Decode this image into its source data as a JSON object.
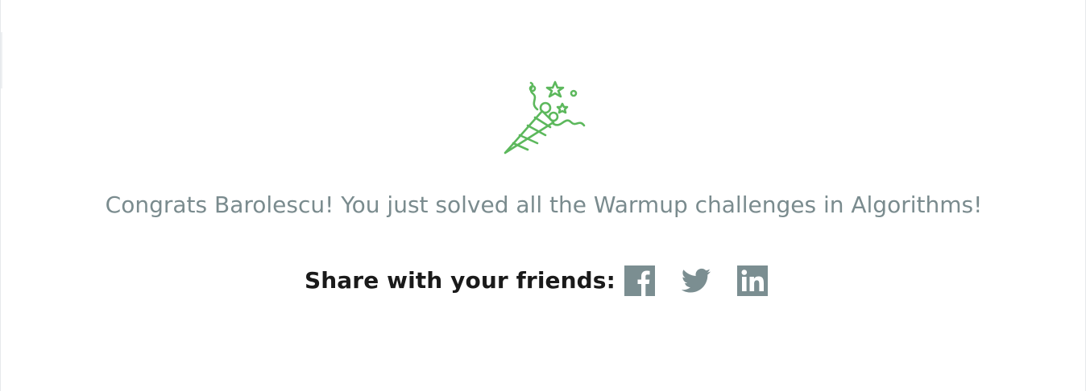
{
  "celebration": {
    "icon": "party-popper-icon",
    "icon_color": "#5cb85c"
  },
  "message": "Congrats Barolescu! You just solved all the Warmup challenges in Algorithms!",
  "share": {
    "label": "Share with your friends:",
    "icon_color": "#7b8e91",
    "networks": [
      {
        "name": "facebook",
        "icon": "facebook-icon"
      },
      {
        "name": "twitter",
        "icon": "twitter-icon"
      },
      {
        "name": "linkedin",
        "icon": "linkedin-icon"
      }
    ]
  }
}
